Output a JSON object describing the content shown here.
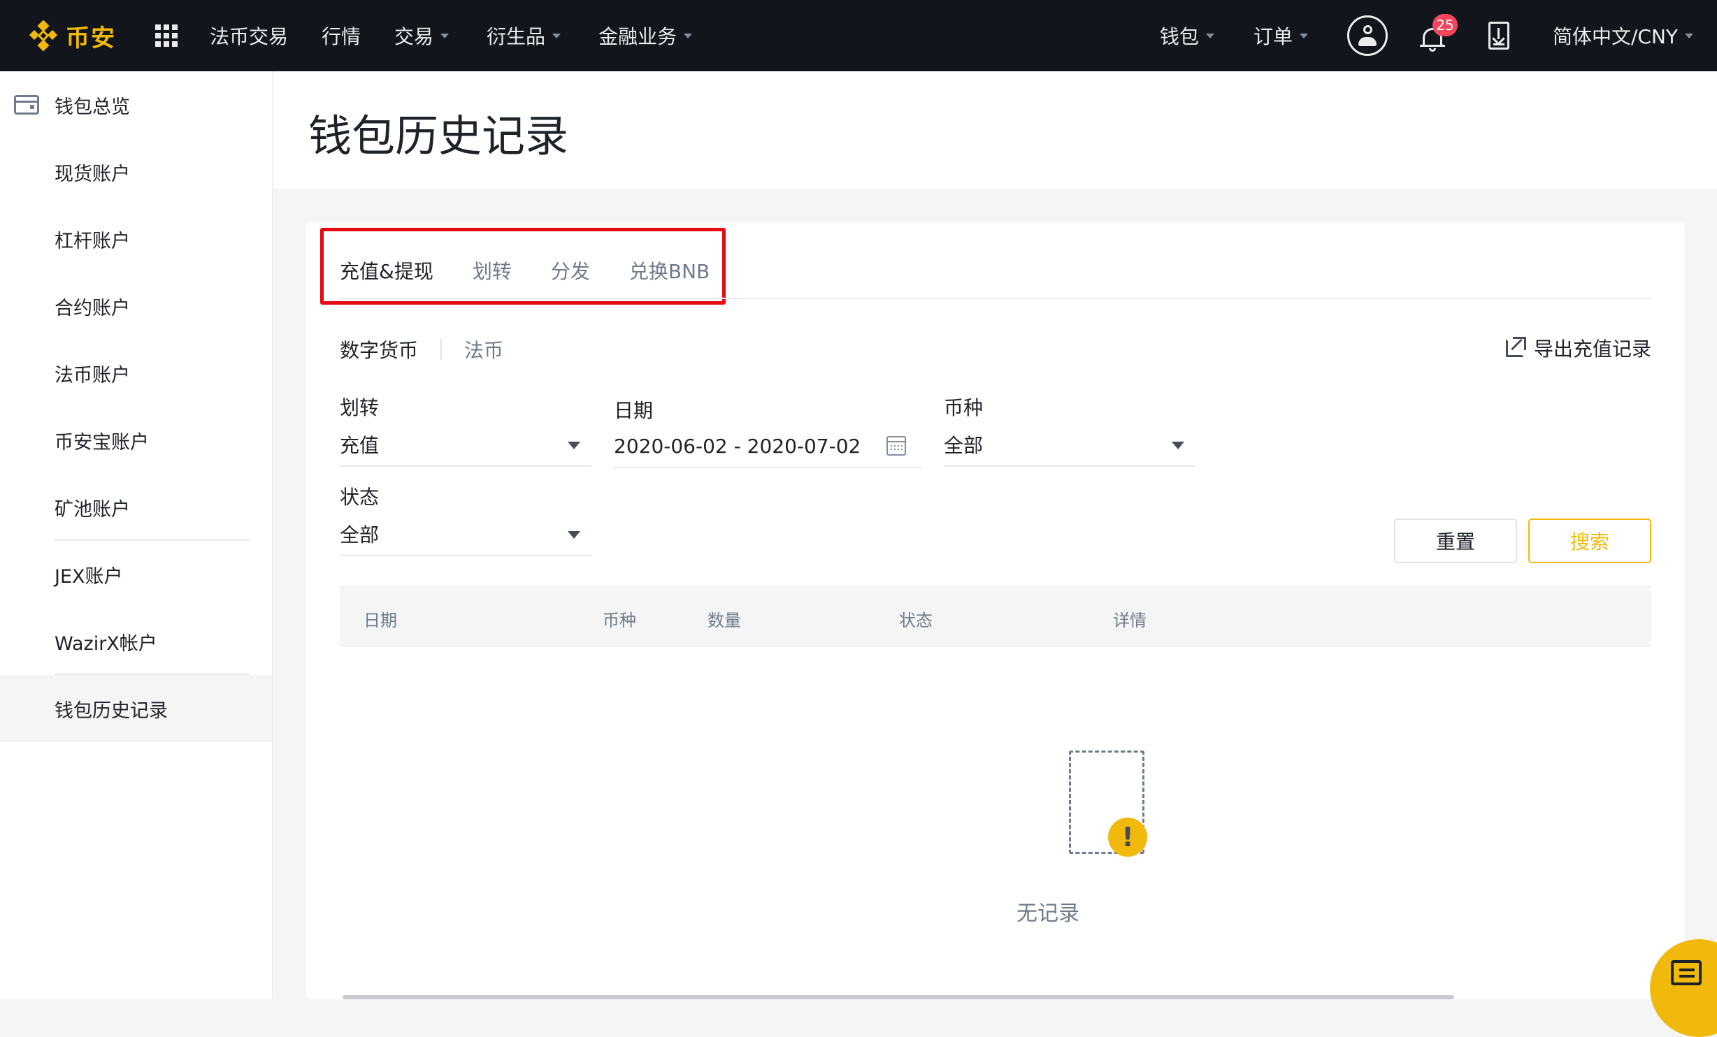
{
  "nav": {
    "logo_text": "币安",
    "items": [
      "法币交易",
      "行情",
      "交易",
      "衍生品",
      "金融业务"
    ],
    "right": {
      "wallet": "钱包",
      "orders": "订单",
      "notifications_count": "25",
      "language": "简体中文/CNY"
    }
  },
  "sidebar": {
    "items": [
      "钱包总览",
      "现货账户",
      "杠杆账户",
      "合约账户",
      "法币账户",
      "币安宝账户",
      "矿池账户",
      "JEX账户",
      "WazirX帐户",
      "钱包历史记录"
    ]
  },
  "page": {
    "title": "钱包历史记录"
  },
  "tabs": [
    "充值&提现",
    "划转",
    "分发",
    "兑换BNB"
  ],
  "subtabs": [
    "数字货币",
    "法币"
  ],
  "export_label": "导出充值记录",
  "filters": {
    "type_label": "划转",
    "type_value": "充值",
    "date_label": "日期",
    "date_value": "2020-06-02 - 2020-07-02",
    "coin_label": "币种",
    "coin_value": "全部",
    "status_label": "状态",
    "status_value": "全部"
  },
  "buttons": {
    "reset": "重置",
    "search": "搜索"
  },
  "table": {
    "headers": [
      "日期",
      "币种",
      "数量",
      "状态",
      "详情"
    ]
  },
  "empty": {
    "text": "无记录",
    "warn_glyph": "!"
  },
  "colors": {
    "brand": "#f0b90b",
    "nav_bg": "#12161c",
    "highlight_box": "#e50914",
    "badge": "#f6465d"
  }
}
